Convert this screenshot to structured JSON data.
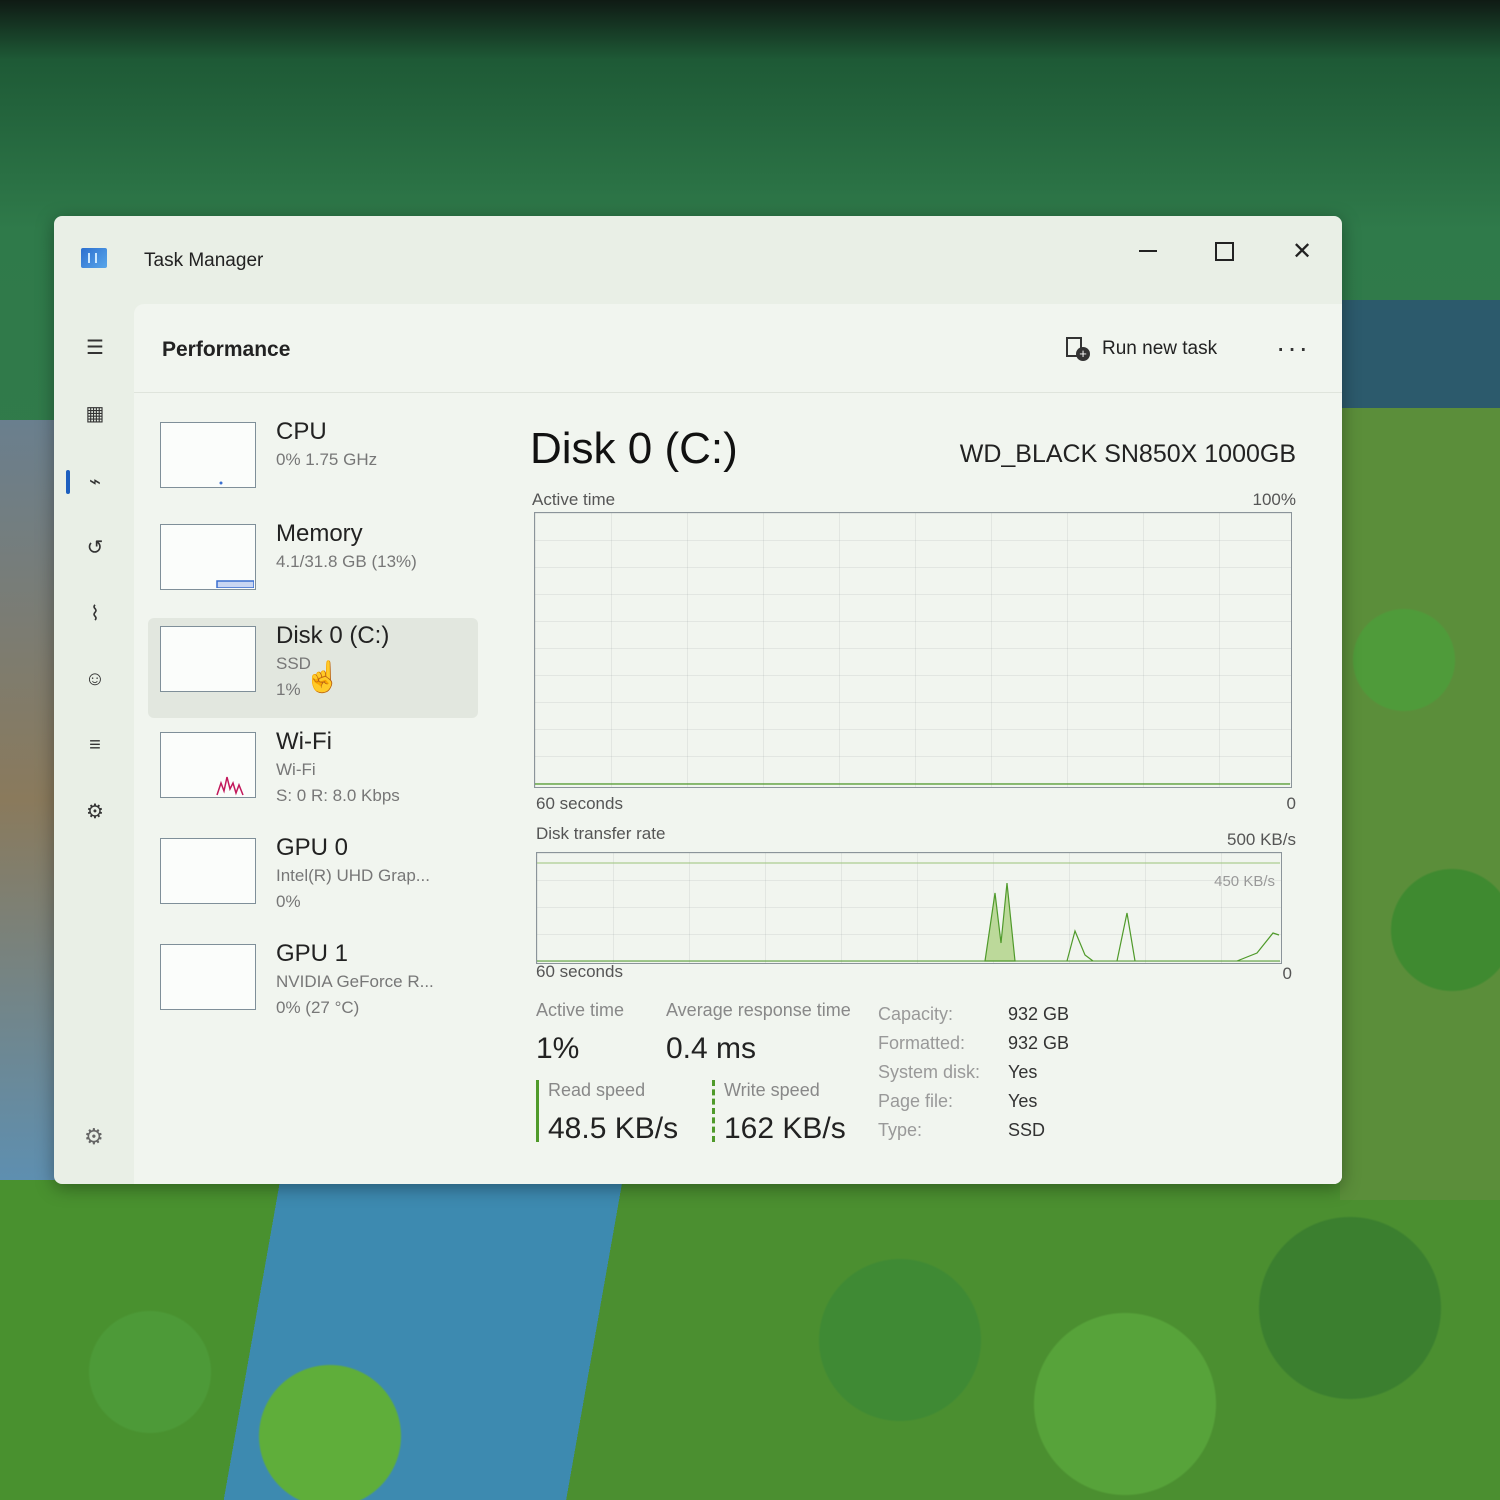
{
  "window": {
    "title": "Task Manager"
  },
  "header": {
    "title": "Performance",
    "run_task_label": "Run new task",
    "more_label": "···"
  },
  "nav": {
    "items": [
      {
        "name": "hamburger-icon",
        "glyph": "☰"
      },
      {
        "name": "processes-icon",
        "glyph": "▦"
      },
      {
        "name": "performance-icon",
        "glyph": "⌁"
      },
      {
        "name": "app-history-icon",
        "glyph": "↺"
      },
      {
        "name": "startup-apps-icon",
        "glyph": "⌇"
      },
      {
        "name": "users-icon",
        "glyph": "☺"
      },
      {
        "name": "details-icon",
        "glyph": "≡"
      },
      {
        "name": "services-icon",
        "glyph": "⚙"
      }
    ],
    "settings_glyph": "⚙"
  },
  "devices": [
    {
      "name": "CPU",
      "sub1": "0% 1.75 GHz",
      "sub2": ""
    },
    {
      "name": "Memory",
      "sub1": "4.1/31.8 GB (13%)",
      "sub2": ""
    },
    {
      "name": "Disk 0 (C:)",
      "sub1": "SSD",
      "sub2": "1%"
    },
    {
      "name": "Wi-Fi",
      "sub1": "Wi-Fi",
      "sub2": "S: 0 R: 8.0 Kbps"
    },
    {
      "name": "GPU 0",
      "sub1": "Intel(R) UHD Grap...",
      "sub2": "0%"
    },
    {
      "name": "GPU 1",
      "sub1": "NVIDIA GeForce R...",
      "sub2": "0% (27 °C)"
    }
  ],
  "detail": {
    "title": "Disk 0 (C:)",
    "model": "WD_BLACK SN850X 1000GB",
    "active_time_label": "Active time",
    "active_time_max": "100%",
    "seconds_label": "60 seconds",
    "zero_label": "0",
    "transfer_label": "Disk transfer rate",
    "transfer_max": "500 KB/s",
    "transfer_ref": "450 KB/s",
    "stats": {
      "active_time_label": "Active time",
      "active_time_value": "1%",
      "response_label": "Average response time",
      "response_value": "0.4 ms",
      "read_label": "Read speed",
      "read_value": "48.5 KB/s",
      "write_label": "Write speed",
      "write_value": "162 KB/s"
    },
    "info": [
      {
        "key": "Capacity:",
        "value": "932 GB"
      },
      {
        "key": "Formatted:",
        "value": "932 GB"
      },
      {
        "key": "System disk:",
        "value": "Yes"
      },
      {
        "key": "Page file:",
        "value": "Yes"
      },
      {
        "key": "Type:",
        "value": "SSD"
      }
    ]
  },
  "colors": {
    "disk_accent": "#4f9a2a",
    "wifi_accent": "#c2185b",
    "memory_accent": "#3a6fd0",
    "selected_bg": "#e2e7df"
  }
}
